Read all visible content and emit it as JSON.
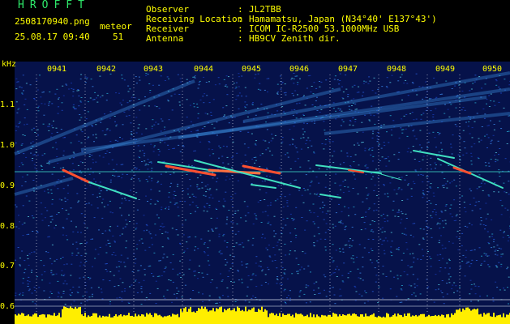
{
  "logo": "HROFFT",
  "file": {
    "name": "2508170940.png",
    "datetime": "25.08.17 09:40",
    "meteor_label": "meteor",
    "meteor_count": "51"
  },
  "info": {
    "labels": [
      "Observer",
      "Receiving Location",
      "Receiver",
      "Antenna"
    ],
    "values": [
      "JL2TBB",
      "Hamamatsu, Japan (N34°40' E137°43')",
      "ICOM IC-R2500 53.1000MHz USB",
      "HB9CV Zenith dir."
    ]
  },
  "axis": {
    "unit": "kHz",
    "y_ticks": [
      "1.1",
      "1.0",
      "0.9",
      "0.8",
      "0.7",
      "0.6"
    ],
    "x_ticks": [
      "0941",
      "0942",
      "0943",
      "0944",
      "0945",
      "0946",
      "0947",
      "0948",
      "0949",
      "0950"
    ]
  },
  "colors": {
    "text": "#ffff00",
    "logo": "#2ee86a",
    "background": "#06124a",
    "signal_strong": "#ff5030",
    "signal_weak": "#40e0c0",
    "level": "#ffee00"
  }
}
